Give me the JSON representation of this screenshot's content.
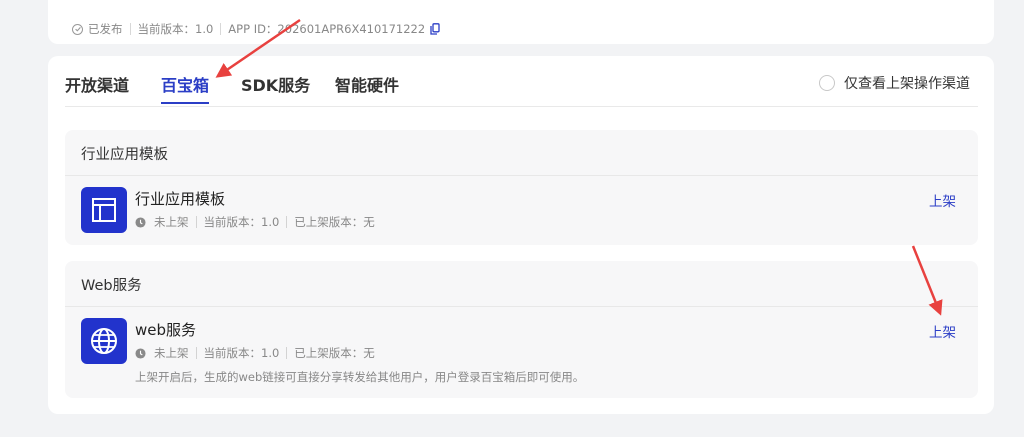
{
  "app_meta": {
    "status": "已发布",
    "current_version": "当前版本：1.0",
    "app_id": "APP ID：202601APR6X410171222"
  },
  "tabs": [
    {
      "label": "开放渠道",
      "active": false
    },
    {
      "label": "百宝箱",
      "active": true
    },
    {
      "label": "SDK服务",
      "active": false
    },
    {
      "label": "智能硬件",
      "active": false
    }
  ],
  "filter": {
    "label": "仅查看上架操作渠道",
    "checked": false
  },
  "sections": [
    {
      "title": "行业应用模板",
      "item": {
        "icon": "layout-template-icon",
        "title": "行业应用模板",
        "status": "未上架",
        "current_version": "当前版本：1.0",
        "published_version": "已上架版本：无",
        "action": "上架"
      }
    },
    {
      "title": "Web服务",
      "item": {
        "icon": "globe-icon",
        "title": "web服务",
        "status": "未上架",
        "current_version": "当前版本：1.0",
        "published_version": "已上架版本：无",
        "description": "上架开启后，生成的web链接可直接分享转发给其他用户，用户登录百宝箱后即可使用。",
        "action": "上架"
      }
    }
  ],
  "colors": {
    "accent": "#2b3ec6",
    "icon_bg": "#2233cc",
    "annotation": "#e8413f"
  }
}
